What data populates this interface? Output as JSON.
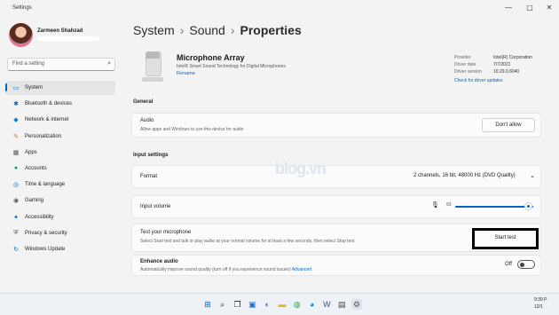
{
  "window": {
    "title": "Settings",
    "controls": [
      "—",
      "▢",
      "✕"
    ]
  },
  "user": {
    "name": "Zarmeen Shahzad"
  },
  "search": {
    "placeholder": "Find a setting"
  },
  "nav": [
    {
      "label": "System",
      "icon": "monitor-icon",
      "glyph": "▭",
      "color": "#0067c0"
    },
    {
      "label": "Bluetooth & devices",
      "icon": "bluetooth-icon",
      "glyph": "✱",
      "color": "#0067c0"
    },
    {
      "label": "Network & internet",
      "icon": "wifi-icon",
      "glyph": "◆",
      "color": "#0a7cd6"
    },
    {
      "label": "Personalization",
      "icon": "brush-icon",
      "glyph": "✎",
      "color": "#d0782a"
    },
    {
      "label": "Apps",
      "icon": "apps-icon",
      "glyph": "▦",
      "color": "#555555"
    },
    {
      "label": "Accounts",
      "icon": "person-icon",
      "glyph": "●",
      "color": "#1f9a5a"
    },
    {
      "label": "Time & language",
      "icon": "globe-icon",
      "glyph": "◎",
      "color": "#0067c0"
    },
    {
      "label": "Gaming",
      "icon": "gamepad-icon",
      "glyph": "◉",
      "color": "#555555"
    },
    {
      "label": "Accessibility",
      "icon": "accessibility-icon",
      "glyph": "✦",
      "color": "#0067c0"
    },
    {
      "label": "Privacy & security",
      "icon": "shield-icon",
      "glyph": "⛨",
      "color": "#555555"
    },
    {
      "label": "Windows Update",
      "icon": "update-icon",
      "glyph": "↻",
      "color": "#0067c0"
    }
  ],
  "breadcrumb": {
    "part1": "System",
    "sep": "›",
    "part2": "Sound",
    "part3": "Properties"
  },
  "device": {
    "name": "Microphone Array",
    "description": "Intel® Smart Sound Technology for Digital Microphones",
    "rename": "Rename",
    "info": [
      {
        "k": "Provider",
        "v": "Intel(R) Corporation"
      },
      {
        "k": "Driver date",
        "v": "7/7/2021"
      },
      {
        "k": "Driver version",
        "v": "10.29.0.6040"
      }
    ],
    "driver_link": "Check for driver updates"
  },
  "general": {
    "title": "General",
    "audio_title": "Audio",
    "audio_sub": "Allow apps and Windows to use this device for audio",
    "dont_allow": "Don't allow"
  },
  "input": {
    "title": "Input settings",
    "format_label": "Format",
    "format_value": "2 channels, 16 bit, 48000 Hz (DVD Quality)",
    "volume_label": "Input volume",
    "volume_value": "93",
    "volume_level": 0.93,
    "test_title": "Test your microphone",
    "test_sub": "Select Start test and talk or play audio at your normal volume for at least a few seconds, then select Stop test",
    "start_test": "Start test",
    "enhance_title": "Enhance audio",
    "enhance_sub": "Automatically improve sound quality (turn off if you experience sound issues)",
    "advanced": "Advanced",
    "toggle_state": "Off"
  },
  "taskbar": {
    "icons": [
      {
        "name": "windows-start-icon",
        "glyph": "⊞",
        "color": "#0067c0"
      },
      {
        "name": "search-icon",
        "glyph": "⌕",
        "color": "#222222"
      },
      {
        "name": "task-view-icon",
        "glyph": "❐",
        "color": "#222222"
      },
      {
        "name": "widgets-icon",
        "glyph": "▣",
        "color": "#1e74d0"
      },
      {
        "name": "chat-icon",
        "glyph": "◐",
        "color": "#6264a7"
      },
      {
        "name": "file-explorer-icon",
        "glyph": "▬",
        "color": "#e7b416"
      },
      {
        "name": "chrome-icon",
        "glyph": "◍",
        "color": "#34a853"
      },
      {
        "name": "edge-icon",
        "glyph": "◕",
        "color": "#0a7cd6"
      },
      {
        "name": "word-icon",
        "glyph": "W",
        "color": "#2b579a"
      },
      {
        "name": "store-icon",
        "glyph": "▤",
        "color": "#444444"
      },
      {
        "name": "settings-icon",
        "glyph": "⚙",
        "color": "#555555"
      }
    ],
    "clock_time": "9:39 P",
    "clock_date": "12/1"
  },
  "watermark": "blog.vn"
}
